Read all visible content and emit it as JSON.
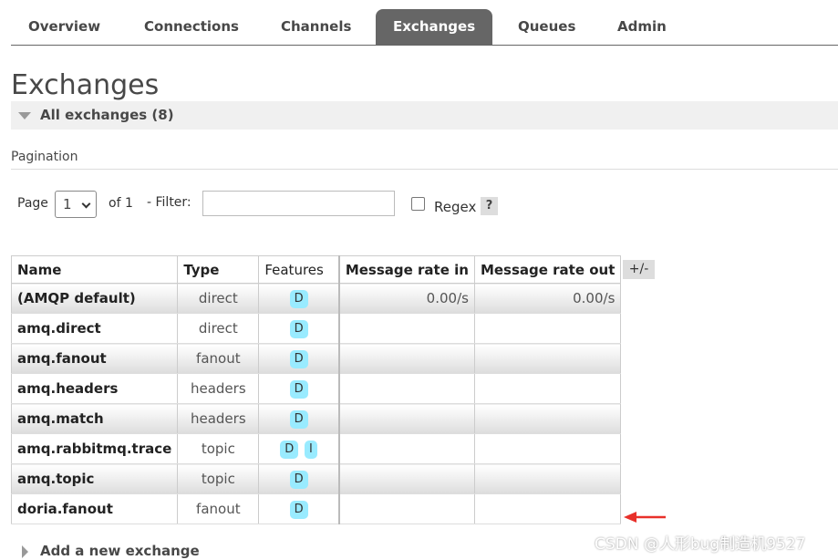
{
  "nav": {
    "tabs": [
      {
        "label": "Overview",
        "active": false
      },
      {
        "label": "Connections",
        "active": false
      },
      {
        "label": "Channels",
        "active": false
      },
      {
        "label": "Exchanges",
        "active": true
      },
      {
        "label": "Queues",
        "active": false
      },
      {
        "label": "Admin",
        "active": false
      }
    ]
  },
  "page": {
    "title": "Exchanges",
    "section_title": "All exchanges (8)"
  },
  "pagination": {
    "label": "Pagination",
    "page_label": "Page",
    "page_value": "1",
    "of_label": "of 1",
    "filter_label": "- Filter:",
    "filter_value": "",
    "regex_label": "Regex",
    "regex_checked": false,
    "help_label": "?"
  },
  "table": {
    "headers": [
      "Name",
      "Type",
      "Features",
      "Message rate in",
      "Message rate out"
    ],
    "column_toggle": "+/-",
    "rows": [
      {
        "name": "(AMQP default)",
        "type": "direct",
        "features": [
          "D"
        ],
        "rate_in": "0.00/s",
        "rate_out": "0.00/s"
      },
      {
        "name": "amq.direct",
        "type": "direct",
        "features": [
          "D"
        ],
        "rate_in": "",
        "rate_out": ""
      },
      {
        "name": "amq.fanout",
        "type": "fanout",
        "features": [
          "D"
        ],
        "rate_in": "",
        "rate_out": ""
      },
      {
        "name": "amq.headers",
        "type": "headers",
        "features": [
          "D"
        ],
        "rate_in": "",
        "rate_out": ""
      },
      {
        "name": "amq.match",
        "type": "headers",
        "features": [
          "D"
        ],
        "rate_in": "",
        "rate_out": ""
      },
      {
        "name": "amq.rabbitmq.trace",
        "type": "topic",
        "features": [
          "D",
          "I"
        ],
        "rate_in": "",
        "rate_out": ""
      },
      {
        "name": "amq.topic",
        "type": "topic",
        "features": [
          "D"
        ],
        "rate_in": "",
        "rate_out": ""
      },
      {
        "name": "doria.fanout",
        "type": "fanout",
        "features": [
          "D"
        ],
        "rate_in": "",
        "rate_out": ""
      }
    ]
  },
  "footer": {
    "add_exchange_label": "Add a new exchange"
  },
  "watermark": "CSDN @人形bug制造机9527",
  "colors": {
    "tab_active_bg": "#666666",
    "feature_badge": "#99ebff",
    "annotation_arrow": "#e8302a"
  }
}
